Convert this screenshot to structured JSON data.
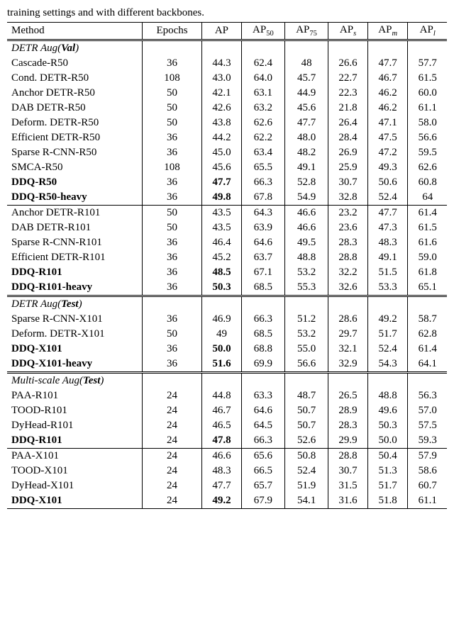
{
  "caption_text": "training settings and with different backbones.",
  "header": [
    "Method",
    "Epochs",
    "AP",
    "AP50",
    "AP75",
    "APs",
    "APm",
    "APl"
  ],
  "sections": [
    {
      "label_prefix": "DETR Aug(",
      "label_bold": "Val",
      "label_suffix": ")",
      "rows": [
        {
          "m": "Cascade-R50",
          "e": "36",
          "ap": "44.3",
          "ap50": "62.4",
          "ap75": "48",
          "aps": "26.6",
          "apm": "47.7",
          "apl": "57.7",
          "b": false
        },
        {
          "m": "Cond. DETR-R50",
          "e": "108",
          "ap": "43.0",
          "ap50": "64.0",
          "ap75": "45.7",
          "aps": "22.7",
          "apm": "46.7",
          "apl": "61.5",
          "b": false
        },
        {
          "m": "Anchor DETR-R50",
          "e": "50",
          "ap": "42.1",
          "ap50": "63.1",
          "ap75": "44.9",
          "aps": "22.3",
          "apm": "46.2",
          "apl": "60.0",
          "b": false
        },
        {
          "m": "DAB DETR-R50",
          "e": "50",
          "ap": "42.6",
          "ap50": "63.2",
          "ap75": "45.6",
          "aps": "21.8",
          "apm": "46.2",
          "apl": "61.1",
          "b": false
        },
        {
          "m": "Deform. DETR-R50",
          "e": "50",
          "ap": "43.8",
          "ap50": "62.6",
          "ap75": "47.7",
          "aps": "26.4",
          "apm": "47.1",
          "apl": "58.0",
          "b": false
        },
        {
          "m": "Efficient DETR-R50",
          "e": "36",
          "ap": "44.2",
          "ap50": "62.2",
          "ap75": "48.0",
          "aps": "28.4",
          "apm": "47.5",
          "apl": "56.6",
          "b": false
        },
        {
          "m": "Sparse R-CNN-R50",
          "e": "36",
          "ap": "45.0",
          "ap50": "63.4",
          "ap75": "48.2",
          "aps": "26.9",
          "apm": "47.2",
          "apl": "59.5",
          "b": false
        },
        {
          "m": "SMCA-R50",
          "e": "108",
          "ap": "45.6",
          "ap50": "65.5",
          "ap75": "49.1",
          "aps": "25.9",
          "apm": "49.3",
          "apl": "62.6",
          "b": false
        },
        {
          "m": "DDQ-R50",
          "e": "36",
          "ap": "47.7",
          "ap50": "66.3",
          "ap75": "52.8",
          "aps": "30.7",
          "apm": "50.6",
          "apl": "60.8",
          "b": true,
          "apbold": true
        },
        {
          "m": "DDQ-R50-heavy",
          "e": "36",
          "ap": "49.8",
          "ap50": "67.8",
          "ap75": "54.9",
          "aps": "32.8",
          "apm": "52.4",
          "apl": "64",
          "b": true,
          "apbold": true
        }
      ],
      "subsections": [
        [
          {
            "m": "Anchor DETR-R101",
            "e": "50",
            "ap": "43.5",
            "ap50": "64.3",
            "ap75": "46.6",
            "aps": "23.2",
            "apm": "47.7",
            "apl": "61.4",
            "b": false
          },
          {
            "m": "DAB DETR-R101",
            "e": "50",
            "ap": "43.5",
            "ap50": "63.9",
            "ap75": "46.6",
            "aps": "23.6",
            "apm": "47.3",
            "apl": "61.5",
            "b": false
          },
          {
            "m": "Sparse R-CNN-R101",
            "e": "36",
            "ap": "46.4",
            "ap50": "64.6",
            "ap75": "49.5",
            "aps": "28.3",
            "apm": "48.3",
            "apl": "61.6",
            "b": false
          },
          {
            "m": "Efficient DETR-R101",
            "e": "36",
            "ap": "45.2",
            "ap50": "63.7",
            "ap75": "48.8",
            "aps": "28.8",
            "apm": "49.1",
            "apl": "59.0",
            "b": false
          },
          {
            "m": "DDQ-R101",
            "e": "36",
            "ap": "48.5",
            "ap50": "67.1",
            "ap75": "53.2",
            "aps": "32.2",
            "apm": "51.5",
            "apl": "61.8",
            "b": true,
            "apbold": true
          },
          {
            "m": "DDQ-R101-heavy",
            "e": "36",
            "ap": "50.3",
            "ap50": "68.5",
            "ap75": "55.3",
            "aps": "32.6",
            "apm": "53.3",
            "apl": "65.1",
            "b": true,
            "apbold": true
          }
        ]
      ]
    },
    {
      "label_prefix": "DETR Aug(",
      "label_bold": "Test",
      "label_suffix": ")",
      "rows": [
        {
          "m": "Sparse R-CNN-X101",
          "e": "36",
          "ap": "46.9",
          "ap50": "66.3",
          "ap75": "51.2",
          "aps": "28.6",
          "apm": "49.2",
          "apl": "58.7",
          "b": false
        },
        {
          "m": "Deform. DETR-X101",
          "e": "50",
          "ap": "49",
          "ap50": "68.5",
          "ap75": "53.2",
          "aps": "29.7",
          "apm": "51.7",
          "apl": "62.8",
          "b": false
        },
        {
          "m": "DDQ-X101",
          "e": "36",
          "ap": "50.0",
          "ap50": "68.8",
          "ap75": "55.0",
          "aps": "32.1",
          "apm": "52.4",
          "apl": "61.4",
          "b": true,
          "apbold": true
        },
        {
          "m": "DDQ-X101-heavy",
          "e": "36",
          "ap": "51.6",
          "ap50": "69.9",
          "ap75": "56.6",
          "aps": "32.9",
          "apm": "54.3",
          "apl": "64.1",
          "b": true,
          "apbold": true
        }
      ],
      "subsections": []
    },
    {
      "label_prefix": "Multi-scale Aug(",
      "label_bold": "Test",
      "label_suffix": ")",
      "rows": [
        {
          "m": "PAA-R101",
          "e": "24",
          "ap": "44.8",
          "ap50": "63.3",
          "ap75": "48.7",
          "aps": "26.5",
          "apm": "48.8",
          "apl": "56.3",
          "b": false
        },
        {
          "m": "TOOD-R101",
          "e": "24",
          "ap": "46.7",
          "ap50": "64.6",
          "ap75": "50.7",
          "aps": "28.9",
          "apm": "49.6",
          "apl": "57.0",
          "b": false
        },
        {
          "m": "DyHead-R101",
          "e": "24",
          "ap": "46.5",
          "ap50": "64.5",
          "ap75": "50.7",
          "aps": "28.3",
          "apm": "50.3",
          "apl": "57.5",
          "b": false
        },
        {
          "m": "DDQ-R101",
          "e": "24",
          "ap": "47.8",
          "ap50": "66.3",
          "ap75": "52.6",
          "aps": "29.9",
          "apm": "50.0",
          "apl": "59.3",
          "b": true,
          "apbold": true
        }
      ],
      "subsections": [
        [
          {
            "m": "PAA-X101",
            "e": "24",
            "ap": "46.6",
            "ap50": "65.6",
            "ap75": "50.8",
            "aps": "28.8",
            "apm": "50.4",
            "apl": "57.9",
            "b": false
          },
          {
            "m": "TOOD-X101",
            "e": "24",
            "ap": "48.3",
            "ap50": "66.5",
            "ap75": "52.4",
            "aps": "30.7",
            "apm": "51.3",
            "apl": "58.6",
            "b": false
          },
          {
            "m": "DyHead-X101",
            "e": "24",
            "ap": "47.7",
            "ap50": "65.7",
            "ap75": "51.9",
            "aps": "31.5",
            "apm": "51.7",
            "apl": "60.7",
            "b": false
          },
          {
            "m": "DDQ-X101",
            "e": "24",
            "ap": "49.2",
            "ap50": "67.9",
            "ap75": "54.1",
            "aps": "31.6",
            "apm": "51.8",
            "apl": "61.1",
            "b": true,
            "apbold": true
          }
        ]
      ]
    }
  ]
}
